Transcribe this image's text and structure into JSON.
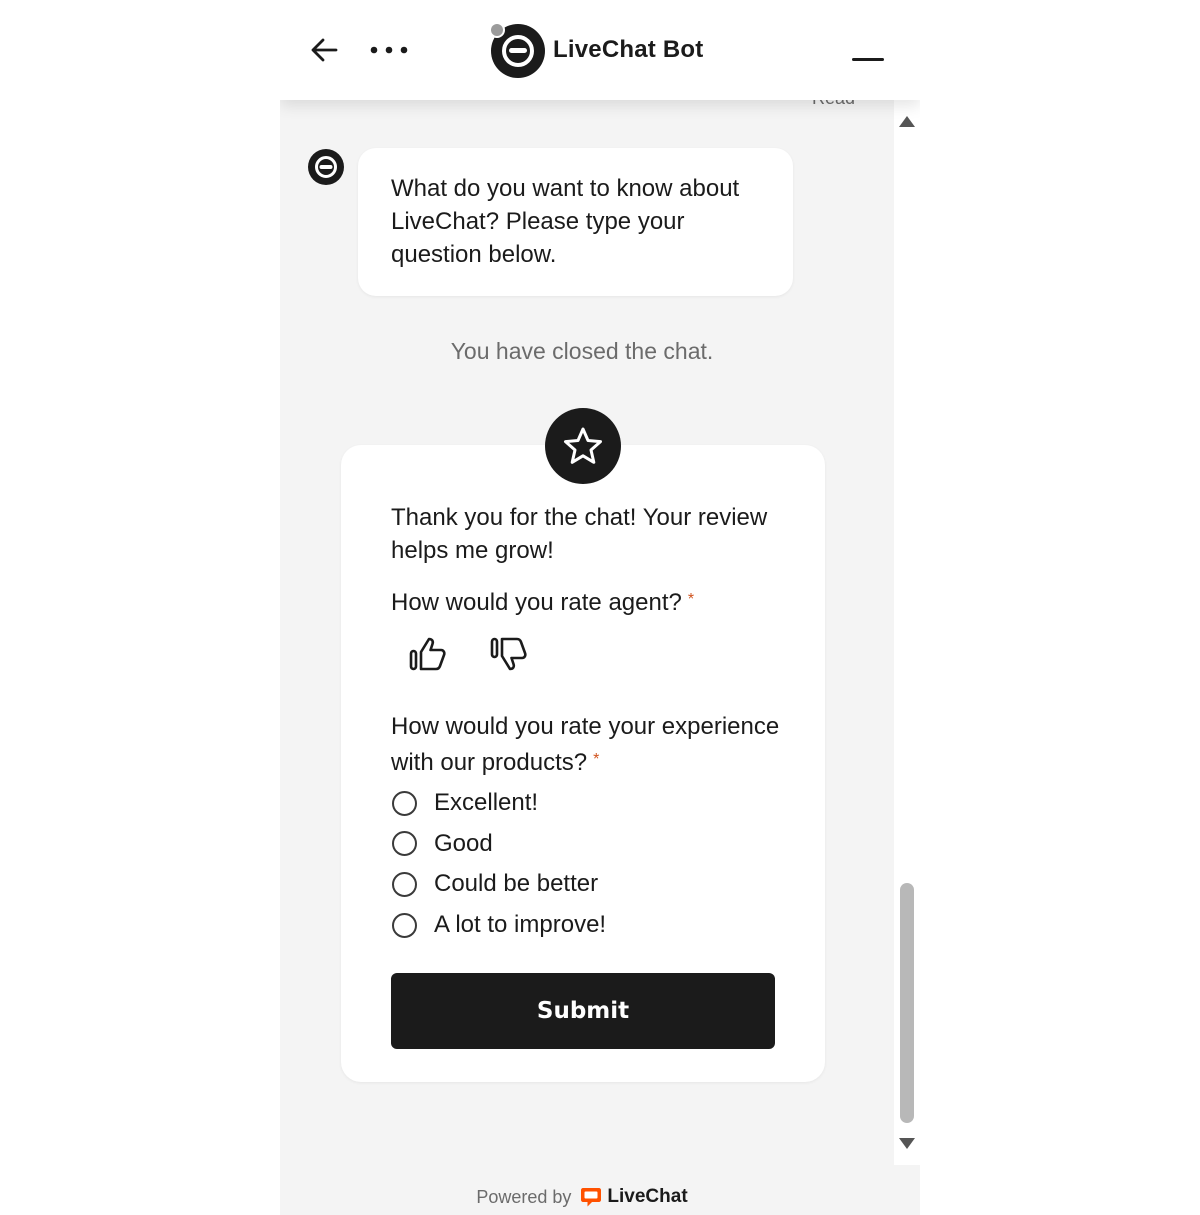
{
  "header": {
    "bot_name": "LiveChat Bot",
    "icons": {
      "back": "arrow-left-icon",
      "more": "more-horizontal-icon",
      "minimize": "minimize-icon",
      "logo": "bot-logo-icon"
    }
  },
  "conversation": {
    "read_status": "Read",
    "bot_message": "What do you want to know about LiveChat? Please type your question below.",
    "system_message": "You have closed the chat."
  },
  "rating": {
    "intro": "Thank you for the chat! Your review helps me grow!",
    "agent_question": "How would you rate agent?",
    "required_mark": "*",
    "product_question": "How would you rate your experience with our products?",
    "options": [
      "Excellent!",
      "Good",
      "Could be better",
      "A lot to improve!"
    ],
    "submit_label": "Submit"
  },
  "footer": {
    "powered_by": "Powered by",
    "brand": "LiveChat"
  },
  "colors": {
    "accent": "#1b1b1b",
    "required": "#d0531e",
    "brand_orange": "#ff5100",
    "background": "#f4f4f4"
  }
}
